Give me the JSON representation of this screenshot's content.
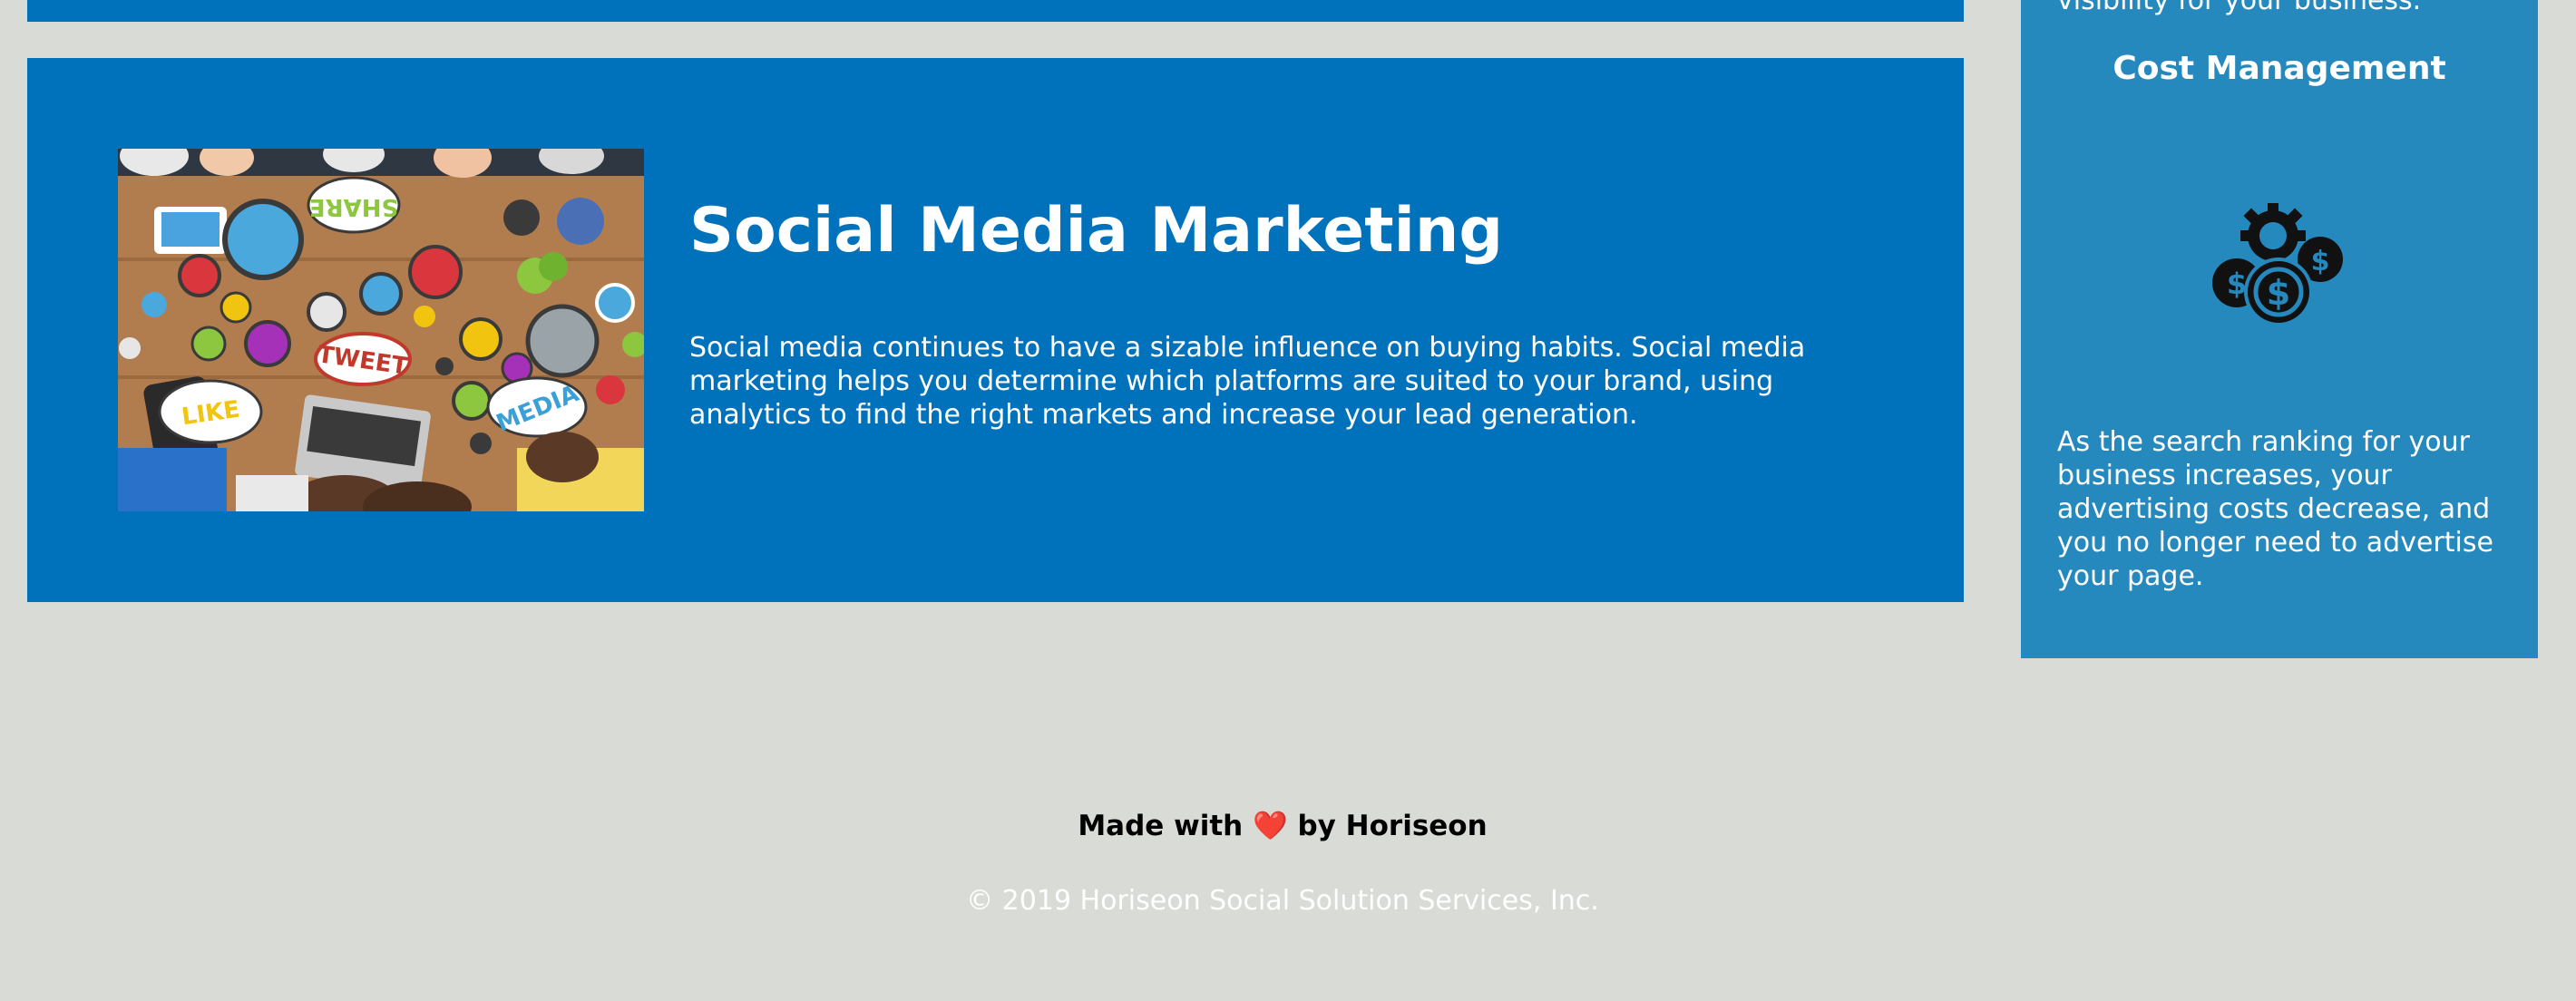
{
  "content": {
    "social": {
      "title": "Social Media Marketing",
      "text": "Social media continues to have a sizable influence on buying habits. Social media marketing helps you determine which platforms are suited to your brand, using analytics to find the right markets and increase your lead generation."
    }
  },
  "image": {
    "labels": {
      "share": "SHARE",
      "tweet": "TWEET",
      "like": "LIKE",
      "media": "MEDIA"
    }
  },
  "sidebar": {
    "prev_text": "visibility for your business.",
    "cost": {
      "title": "Cost Management",
      "icon": "cost-management-icon",
      "text": "As the search ranking for your business increases, your advertising costs decrease, and you no longer need to advertise your page."
    }
  },
  "footer": {
    "made_with_before": "Made with",
    "heart": "❤️",
    "made_with_after": "by Horiseon",
    "copyright": "© 2019 Horiseon Social Solution Services, Inc."
  },
  "colors": {
    "page_background": "#d9dcd6",
    "content_background": "#0072bb",
    "sidebar_background": "#2589bd",
    "heart": "#e3000b"
  }
}
